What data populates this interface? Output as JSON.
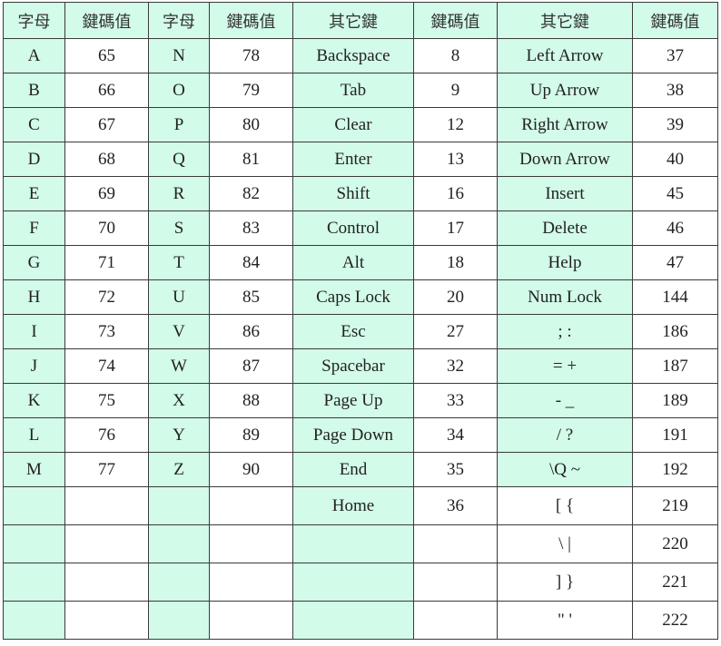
{
  "headers": [
    "字母",
    "鍵碼值",
    "字母",
    "鍵碼值",
    "其它鍵",
    "鍵碼值",
    "其它鍵",
    "鍵碼值"
  ],
  "colors": {
    "mint": "#d2fbe9",
    "white": "#ffffff",
    "border": "#3a3a3a"
  },
  "rows": [
    [
      "A",
      "65",
      "N",
      "78",
      "Backspace",
      "8",
      "Left Arrow",
      "37"
    ],
    [
      "B",
      "66",
      "O",
      "79",
      "Tab",
      "9",
      "Up Arrow",
      "38"
    ],
    [
      "C",
      "67",
      "P",
      "80",
      "Clear",
      "12",
      "Right Arrow",
      "39"
    ],
    [
      "D",
      "68",
      "Q",
      "81",
      "Enter",
      "13",
      "Down Arrow",
      "40"
    ],
    [
      "E",
      "69",
      "R",
      "82",
      "Shift",
      "16",
      "Insert",
      "45"
    ],
    [
      "F",
      "70",
      "S",
      "83",
      "Control",
      "17",
      "Delete",
      "46"
    ],
    [
      "G",
      "71",
      "T",
      "84",
      "Alt",
      "18",
      "Help",
      "47"
    ],
    [
      "H",
      "72",
      "U",
      "85",
      "Caps Lock",
      "20",
      "Num Lock",
      "144"
    ],
    [
      "I",
      "73",
      "V",
      "86",
      "Esc",
      "27",
      "; :",
      "186"
    ],
    [
      "J",
      "74",
      "W",
      "87",
      "Spacebar",
      "32",
      "= +",
      "187"
    ],
    [
      "K",
      "75",
      "X",
      "88",
      "Page Up",
      "33",
      "- _",
      "189"
    ],
    [
      "L",
      "76",
      "Y",
      "89",
      "Page Down",
      "34",
      "/ ?",
      "191"
    ],
    [
      "M",
      "77",
      "Z",
      "90",
      "End",
      "35",
      "\\Q ~",
      "192"
    ],
    [
      "",
      "",
      "",
      "",
      "Home",
      "36",
      "[ {",
      "219"
    ],
    [
      "",
      "",
      "",
      "",
      "",
      "",
      "\\ |",
      "220"
    ],
    [
      "",
      "",
      "",
      "",
      "",
      "",
      "] }",
      "221"
    ],
    [
      "",
      "",
      "",
      "",
      "",
      "",
      "\" '",
      "222"
    ]
  ]
}
